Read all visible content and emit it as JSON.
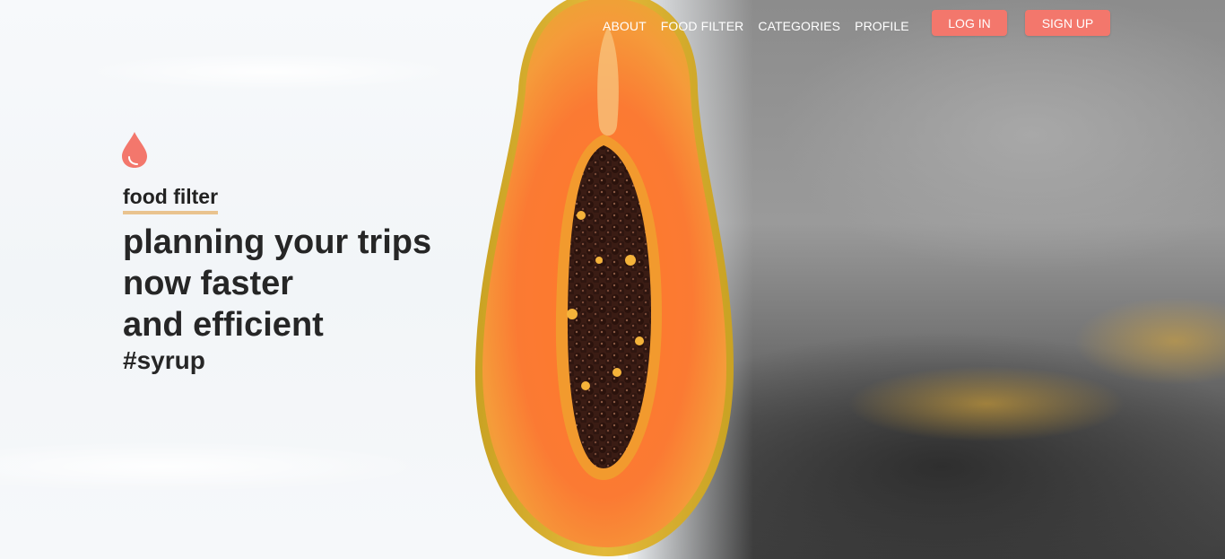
{
  "nav": {
    "links": [
      "ABOUT",
      "FOOD FILTER",
      "CATEGORIES",
      "PROFILE"
    ],
    "login_label": "LOG IN",
    "signup_label": "SIGN UP"
  },
  "hero": {
    "icon": "drop-icon",
    "kicker": "food filter",
    "headline_lines": [
      "planning your trips",
      "now faster",
      "and efficient"
    ],
    "hashtag": "#syrup"
  },
  "colors": {
    "accent": "#f3776c",
    "underline": "#e9c38f",
    "heading": "#262626"
  }
}
